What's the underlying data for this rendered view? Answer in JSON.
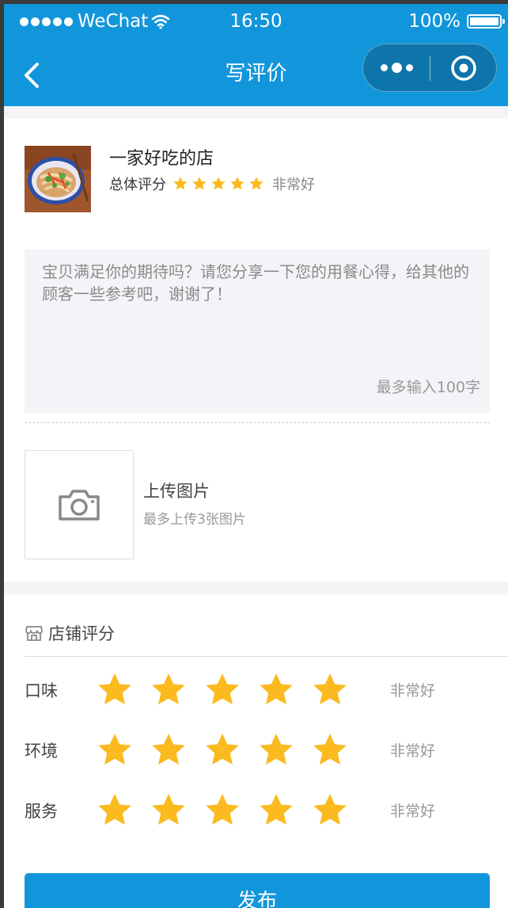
{
  "status_bar": {
    "carrier": "WeChat",
    "time": "16:50",
    "battery": "100%"
  },
  "nav": {
    "title": "写评价"
  },
  "shop": {
    "name": "一家好吃的店",
    "overall_label": "总体评分",
    "overall_stars": 5,
    "overall_text": "非常好"
  },
  "comment": {
    "placeholder": "宝贝满足你的期待吗？请您分享一下您的用餐心得，给其他的顾客一些参考吧，谢谢了！",
    "limit_text": "最多输入100字"
  },
  "upload": {
    "title": "上传图片",
    "hint": "最多上传3张图片"
  },
  "store_rating": {
    "title": "店铺评分",
    "items": [
      {
        "label": "口味",
        "stars": 5,
        "text": "非常好"
      },
      {
        "label": "环境",
        "stars": 5,
        "text": "非常好"
      },
      {
        "label": "服务",
        "stars": 5,
        "text": "非常好"
      }
    ]
  },
  "publish_label": "发布",
  "colors": {
    "brand": "#1296db",
    "star": "#fbba1f",
    "page_bg": "#f4f4f6"
  }
}
